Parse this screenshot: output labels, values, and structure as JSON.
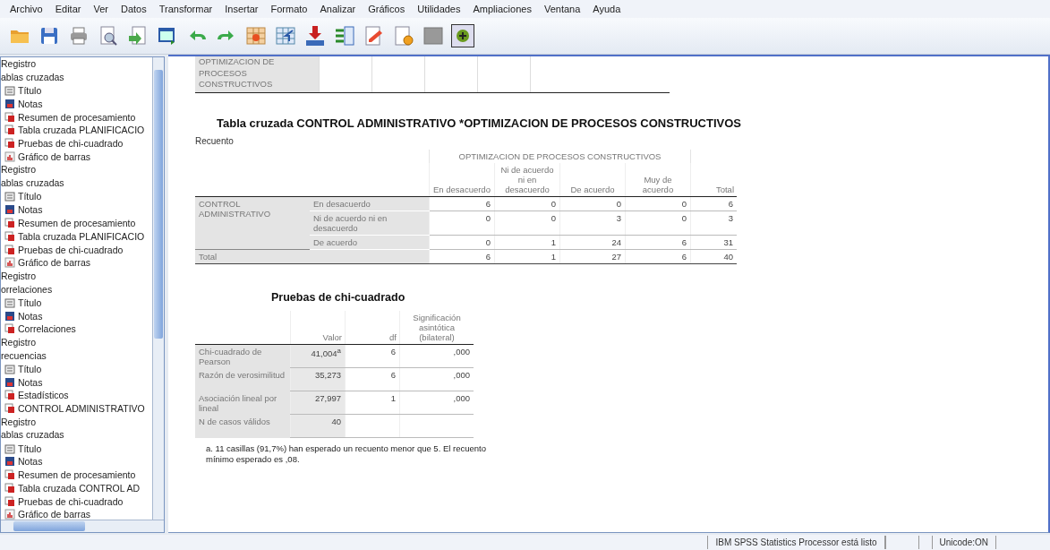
{
  "menu": [
    "Archivo",
    "Editar",
    "Ver",
    "Datos",
    "Transformar",
    "Insertar",
    "Formato",
    "Analizar",
    "Gráficos",
    "Utilidades",
    "Ampliaciones",
    "Ventana",
    "Ayuda"
  ],
  "sidebar": {
    "items": [
      {
        "label": "Registro"
      },
      {
        "label": "ablas cruzadas",
        "children": [
          {
            "label": "Título",
            "kind": "title"
          },
          {
            "label": "Notas",
            "kind": "notes"
          },
          {
            "label": "Resumen de procesamiento",
            "kind": "table"
          },
          {
            "label": "Tabla cruzada PLANIFICACIO",
            "kind": "table"
          },
          {
            "label": "Pruebas de chi-cuadrado",
            "kind": "table"
          },
          {
            "label": "Gráfico de barras",
            "kind": "chart"
          }
        ]
      },
      {
        "label": "Registro"
      },
      {
        "label": "ablas cruzadas",
        "children": [
          {
            "label": "Título",
            "kind": "title"
          },
          {
            "label": "Notas",
            "kind": "notes"
          },
          {
            "label": "Resumen de procesamiento",
            "kind": "table"
          },
          {
            "label": "Tabla cruzada PLANIFICACIO",
            "kind": "table"
          },
          {
            "label": "Pruebas de chi-cuadrado",
            "kind": "table"
          },
          {
            "label": "Gráfico de barras",
            "kind": "chart"
          }
        ]
      },
      {
        "label": "Registro"
      },
      {
        "label": "orrelaciones",
        "children": [
          {
            "label": "Título",
            "kind": "title"
          },
          {
            "label": "Notas",
            "kind": "notes"
          },
          {
            "label": "Correlaciones",
            "kind": "table"
          }
        ]
      },
      {
        "label": "Registro"
      },
      {
        "label": "recuencias",
        "children": [
          {
            "label": "Título",
            "kind": "title"
          },
          {
            "label": "Notas",
            "kind": "notes"
          },
          {
            "label": "Estadísticos",
            "kind": "table"
          },
          {
            "label": "CONTROL ADMINISTRATIVO",
            "kind": "table"
          }
        ]
      },
      {
        "label": "Registro"
      },
      {
        "label": "ablas cruzadas",
        "children": [
          {
            "label": "Título",
            "kind": "title"
          },
          {
            "label": "Notas",
            "kind": "notes"
          },
          {
            "label": "Resumen de procesamiento",
            "kind": "table"
          },
          {
            "label": "Tabla cruzada CONTROL AD",
            "kind": "table"
          },
          {
            "label": "Pruebas de chi-cuadrado",
            "kind": "table"
          },
          {
            "label": "Gráfico de barras",
            "kind": "chart"
          }
        ]
      }
    ]
  },
  "previous_table": {
    "row_header": "OPTIMIZACION DE PROCESOS CONSTRUCTIVOS"
  },
  "crosstab": {
    "title": "Tabla cruzada CONTROL ADMINISTRATIVO *OPTIMIZACION DE PROCESOS CONSTRUCTIVOS",
    "subtitle": "Recuento",
    "column_group": "OPTIMIZACION DE PROCESOS CONSTRUCTIVOS",
    "columns": [
      "En desacuerdo",
      "Ni de acuerdo ni en desacuerdo",
      "De acuerdo",
      "Muy de acuerdo"
    ],
    "total_header": "Total",
    "row_group": "CONTROL ADMINISTRATIVO",
    "rows": [
      {
        "label": "En desacuerdo",
        "values": [
          "6",
          "0",
          "0",
          "0"
        ],
        "total": "6"
      },
      {
        "label": "Ni de acuerdo ni en desacuerdo",
        "values": [
          "0",
          "0",
          "3",
          "0"
        ],
        "total": "3"
      },
      {
        "label": "De acuerdo",
        "values": [
          "0",
          "1",
          "24",
          "6"
        ],
        "total": "31"
      }
    ],
    "total_row": {
      "label": "Total",
      "values": [
        "6",
        "1",
        "27",
        "6"
      ],
      "total": "40"
    }
  },
  "chi_square": {
    "title": "Pruebas de chi-cuadrado",
    "columns": [
      "Valor",
      "df",
      "Significación asintótica (bilateral)"
    ],
    "rows": [
      {
        "label": "Chi-cuadrado de Pearson",
        "values": [
          "41,004$^{a}$",
          "6",
          ",000"
        ]
      },
      {
        "label": "Razón de verosimilitud",
        "values": [
          "35,273",
          "6",
          ",000"
        ]
      },
      {
        "label": "Asociación lineal por lineal",
        "values": [
          "27,997",
          "1",
          ",000"
        ]
      },
      {
        "label": "N de casos válidos",
        "values": [
          "40"
        ]
      }
    ],
    "footnote": "a. 11 casillas (91,7%) han esperado un recuento menor que 5. El recuento mínimo esperado es ,08."
  },
  "status_bar": {
    "message": "IBM SPSS Statistics Processor está listo",
    "encoding": "Unicode:ON"
  }
}
